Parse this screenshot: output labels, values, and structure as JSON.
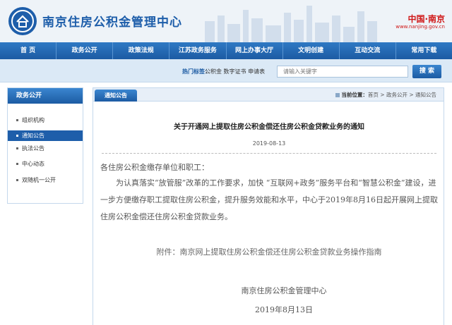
{
  "header": {
    "site_title": "南京住房公积金管理中心",
    "brand": "中国·南京",
    "brand_sub": "www.nanjing.gov.cn"
  },
  "nav": {
    "items": [
      "首 页",
      "政务公开",
      "政策法规",
      "江苏政务服务",
      "网上办事大厅",
      "文明创建",
      "互动交流",
      "常用下载"
    ]
  },
  "search": {
    "hot_label": "热门标签：",
    "hot_items": "公积金  数字证书  申请表",
    "placeholder": "请输入关键字",
    "button": "搜 索"
  },
  "sidebar": {
    "heading": "政务公开",
    "items": [
      {
        "label": "组织机构",
        "active": false
      },
      {
        "label": "通知公告",
        "active": true
      },
      {
        "label": "执法公告",
        "active": false
      },
      {
        "label": "中心动态",
        "active": false
      },
      {
        "label": "双随机一公开",
        "active": false
      }
    ]
  },
  "main": {
    "tab": "通知公告",
    "breadcrumb_prefix": "当前位置：",
    "breadcrumb_rest": "首页 > 政务公开 > 通知公告",
    "title": "关于开通网上提取住房公积金偿还住房公积金贷款业务的通知",
    "date": "2019-08-13",
    "salutation": "各住房公积金缴存单位和职工：",
    "paragraph": "为认真落实“放管服”改革的工作要求，加快 “互联网+政务”服务平台和“智慧公积金”建设，进一步方便缴存职工提取住房公积金，提升服务效能和水平，中心于2019年8月16日起开展网上提取住房公积金偿还住房公积金贷款业务。",
    "attachment": "附件：南京网上提取住房公积金偿还住房公积金贷款业务操作指南",
    "sign_org": "南京住房公积金管理中心",
    "sign_date": "2019年8月13日"
  },
  "colors": {
    "primary": "#1e5eaa",
    "nav_bg": "#2f79c4",
    "search_bg": "#dbe9f6",
    "brand_red": "#d01818"
  }
}
